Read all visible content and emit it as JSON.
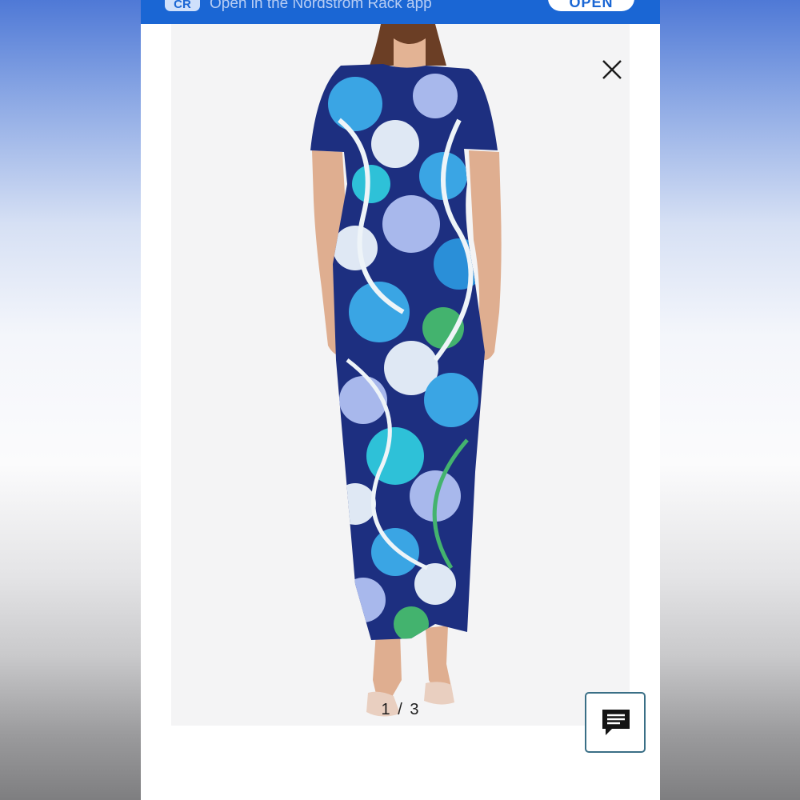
{
  "banner": {
    "app_icon_label": "CR",
    "text": "Open in the Nordstrom Rack app",
    "open_label": "OPEN"
  },
  "gallery": {
    "counter": "1 / 3",
    "image_alt": "Blue floral print short sleeve maxi dress"
  },
  "icons": {
    "close": "close-icon",
    "chat": "chat-icon"
  },
  "colors": {
    "banner_bg": "#1a66d4",
    "chat_border": "#3a6f86"
  }
}
